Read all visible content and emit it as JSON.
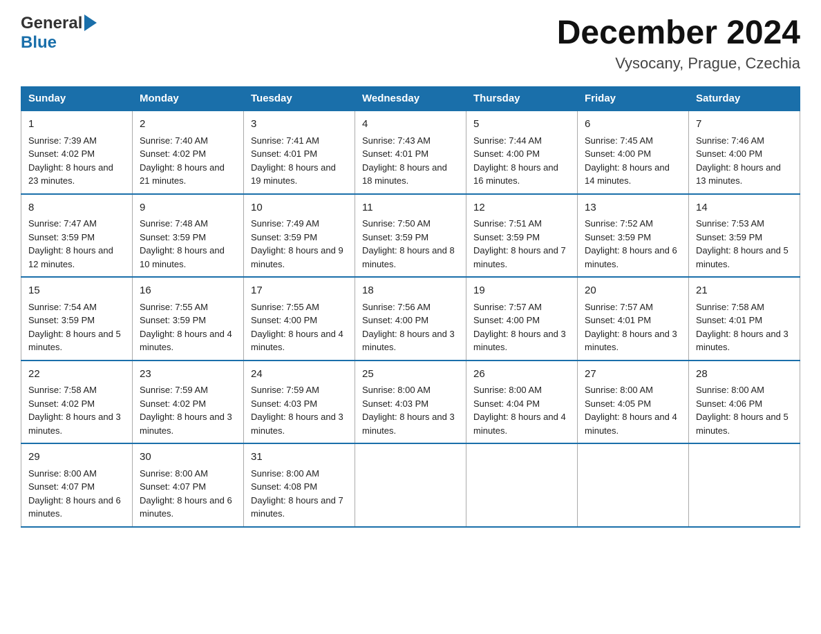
{
  "header": {
    "logo_general": "General",
    "logo_blue": "Blue",
    "month_title": "December 2024",
    "subtitle": "Vysocany, Prague, Czechia"
  },
  "weekdays": [
    "Sunday",
    "Monday",
    "Tuesday",
    "Wednesday",
    "Thursday",
    "Friday",
    "Saturday"
  ],
  "weeks": [
    [
      {
        "day": "1",
        "sunrise": "Sunrise: 7:39 AM",
        "sunset": "Sunset: 4:02 PM",
        "daylight": "Daylight: 8 hours and 23 minutes."
      },
      {
        "day": "2",
        "sunrise": "Sunrise: 7:40 AM",
        "sunset": "Sunset: 4:02 PM",
        "daylight": "Daylight: 8 hours and 21 minutes."
      },
      {
        "day": "3",
        "sunrise": "Sunrise: 7:41 AM",
        "sunset": "Sunset: 4:01 PM",
        "daylight": "Daylight: 8 hours and 19 minutes."
      },
      {
        "day": "4",
        "sunrise": "Sunrise: 7:43 AM",
        "sunset": "Sunset: 4:01 PM",
        "daylight": "Daylight: 8 hours and 18 minutes."
      },
      {
        "day": "5",
        "sunrise": "Sunrise: 7:44 AM",
        "sunset": "Sunset: 4:00 PM",
        "daylight": "Daylight: 8 hours and 16 minutes."
      },
      {
        "day": "6",
        "sunrise": "Sunrise: 7:45 AM",
        "sunset": "Sunset: 4:00 PM",
        "daylight": "Daylight: 8 hours and 14 minutes."
      },
      {
        "day": "7",
        "sunrise": "Sunrise: 7:46 AM",
        "sunset": "Sunset: 4:00 PM",
        "daylight": "Daylight: 8 hours and 13 minutes."
      }
    ],
    [
      {
        "day": "8",
        "sunrise": "Sunrise: 7:47 AM",
        "sunset": "Sunset: 3:59 PM",
        "daylight": "Daylight: 8 hours and 12 minutes."
      },
      {
        "day": "9",
        "sunrise": "Sunrise: 7:48 AM",
        "sunset": "Sunset: 3:59 PM",
        "daylight": "Daylight: 8 hours and 10 minutes."
      },
      {
        "day": "10",
        "sunrise": "Sunrise: 7:49 AM",
        "sunset": "Sunset: 3:59 PM",
        "daylight": "Daylight: 8 hours and 9 minutes."
      },
      {
        "day": "11",
        "sunrise": "Sunrise: 7:50 AM",
        "sunset": "Sunset: 3:59 PM",
        "daylight": "Daylight: 8 hours and 8 minutes."
      },
      {
        "day": "12",
        "sunrise": "Sunrise: 7:51 AM",
        "sunset": "Sunset: 3:59 PM",
        "daylight": "Daylight: 8 hours and 7 minutes."
      },
      {
        "day": "13",
        "sunrise": "Sunrise: 7:52 AM",
        "sunset": "Sunset: 3:59 PM",
        "daylight": "Daylight: 8 hours and 6 minutes."
      },
      {
        "day": "14",
        "sunrise": "Sunrise: 7:53 AM",
        "sunset": "Sunset: 3:59 PM",
        "daylight": "Daylight: 8 hours and 5 minutes."
      }
    ],
    [
      {
        "day": "15",
        "sunrise": "Sunrise: 7:54 AM",
        "sunset": "Sunset: 3:59 PM",
        "daylight": "Daylight: 8 hours and 5 minutes."
      },
      {
        "day": "16",
        "sunrise": "Sunrise: 7:55 AM",
        "sunset": "Sunset: 3:59 PM",
        "daylight": "Daylight: 8 hours and 4 minutes."
      },
      {
        "day": "17",
        "sunrise": "Sunrise: 7:55 AM",
        "sunset": "Sunset: 4:00 PM",
        "daylight": "Daylight: 8 hours and 4 minutes."
      },
      {
        "day": "18",
        "sunrise": "Sunrise: 7:56 AM",
        "sunset": "Sunset: 4:00 PM",
        "daylight": "Daylight: 8 hours and 3 minutes."
      },
      {
        "day": "19",
        "sunrise": "Sunrise: 7:57 AM",
        "sunset": "Sunset: 4:00 PM",
        "daylight": "Daylight: 8 hours and 3 minutes."
      },
      {
        "day": "20",
        "sunrise": "Sunrise: 7:57 AM",
        "sunset": "Sunset: 4:01 PM",
        "daylight": "Daylight: 8 hours and 3 minutes."
      },
      {
        "day": "21",
        "sunrise": "Sunrise: 7:58 AM",
        "sunset": "Sunset: 4:01 PM",
        "daylight": "Daylight: 8 hours and 3 minutes."
      }
    ],
    [
      {
        "day": "22",
        "sunrise": "Sunrise: 7:58 AM",
        "sunset": "Sunset: 4:02 PM",
        "daylight": "Daylight: 8 hours and 3 minutes."
      },
      {
        "day": "23",
        "sunrise": "Sunrise: 7:59 AM",
        "sunset": "Sunset: 4:02 PM",
        "daylight": "Daylight: 8 hours and 3 minutes."
      },
      {
        "day": "24",
        "sunrise": "Sunrise: 7:59 AM",
        "sunset": "Sunset: 4:03 PM",
        "daylight": "Daylight: 8 hours and 3 minutes."
      },
      {
        "day": "25",
        "sunrise": "Sunrise: 8:00 AM",
        "sunset": "Sunset: 4:03 PM",
        "daylight": "Daylight: 8 hours and 3 minutes."
      },
      {
        "day": "26",
        "sunrise": "Sunrise: 8:00 AM",
        "sunset": "Sunset: 4:04 PM",
        "daylight": "Daylight: 8 hours and 4 minutes."
      },
      {
        "day": "27",
        "sunrise": "Sunrise: 8:00 AM",
        "sunset": "Sunset: 4:05 PM",
        "daylight": "Daylight: 8 hours and 4 minutes."
      },
      {
        "day": "28",
        "sunrise": "Sunrise: 8:00 AM",
        "sunset": "Sunset: 4:06 PM",
        "daylight": "Daylight: 8 hours and 5 minutes."
      }
    ],
    [
      {
        "day": "29",
        "sunrise": "Sunrise: 8:00 AM",
        "sunset": "Sunset: 4:07 PM",
        "daylight": "Daylight: 8 hours and 6 minutes."
      },
      {
        "day": "30",
        "sunrise": "Sunrise: 8:00 AM",
        "sunset": "Sunset: 4:07 PM",
        "daylight": "Daylight: 8 hours and 6 minutes."
      },
      {
        "day": "31",
        "sunrise": "Sunrise: 8:00 AM",
        "sunset": "Sunset: 4:08 PM",
        "daylight": "Daylight: 8 hours and 7 minutes."
      },
      null,
      null,
      null,
      null
    ]
  ]
}
